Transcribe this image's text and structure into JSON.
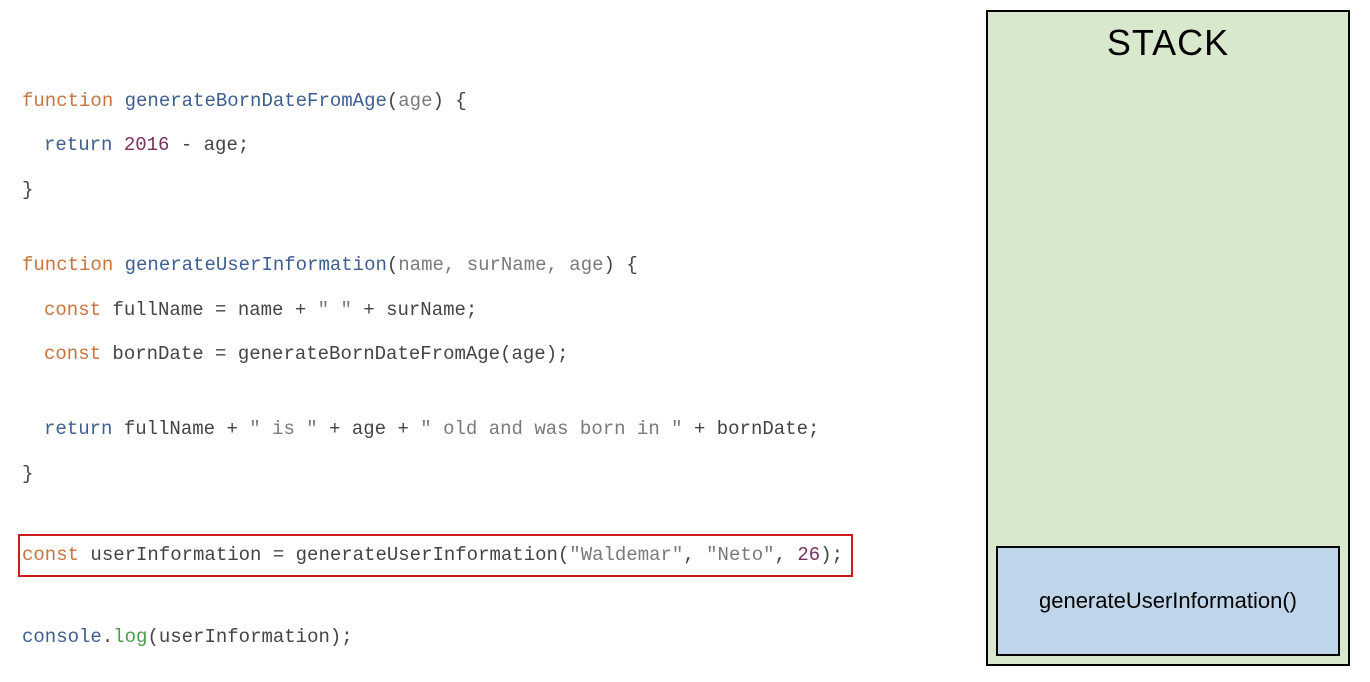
{
  "code": {
    "line1": {
      "kw": "function",
      "name": "generateBornDateFromAge",
      "open": "(",
      "param": "age",
      "close": ") {"
    },
    "line2": {
      "kw": "return",
      "num": "2016",
      "op": " - ",
      "var": "age",
      "end": ";"
    },
    "line3": "}",
    "line4": {
      "kw": "function",
      "name": "generateUserInformation",
      "open": "(",
      "params": "name, surName, age",
      "close": ") {"
    },
    "line5": {
      "kw": "const",
      "var": " fullName = name + ",
      "str": "\" \"",
      "rest": " + surName;"
    },
    "line6": {
      "kw": "const",
      "var": " bornDate = generateBornDateFromAge(age);"
    },
    "line7": {
      "kw": "return",
      "a": " fullName + ",
      "s1": "\" is \"",
      "b": " + age + ",
      "s2": "\" old and was born in \"",
      "c": " + bornDate;"
    },
    "line8": "}",
    "line9": {
      "kw": "const",
      "var": " userInformation = generateUserInformation(",
      "s1": "\"Waldemar\"",
      "comma1": ", ",
      "s2": "\"Neto\"",
      "comma2": ", ",
      "num": "26",
      "end": ");"
    },
    "line10": {
      "obj": "console",
      "dot": ".",
      "method": "log",
      "rest": "(userInformation);"
    }
  },
  "stack": {
    "title": "STACK",
    "frames": [
      "generateUserInformation()"
    ]
  }
}
